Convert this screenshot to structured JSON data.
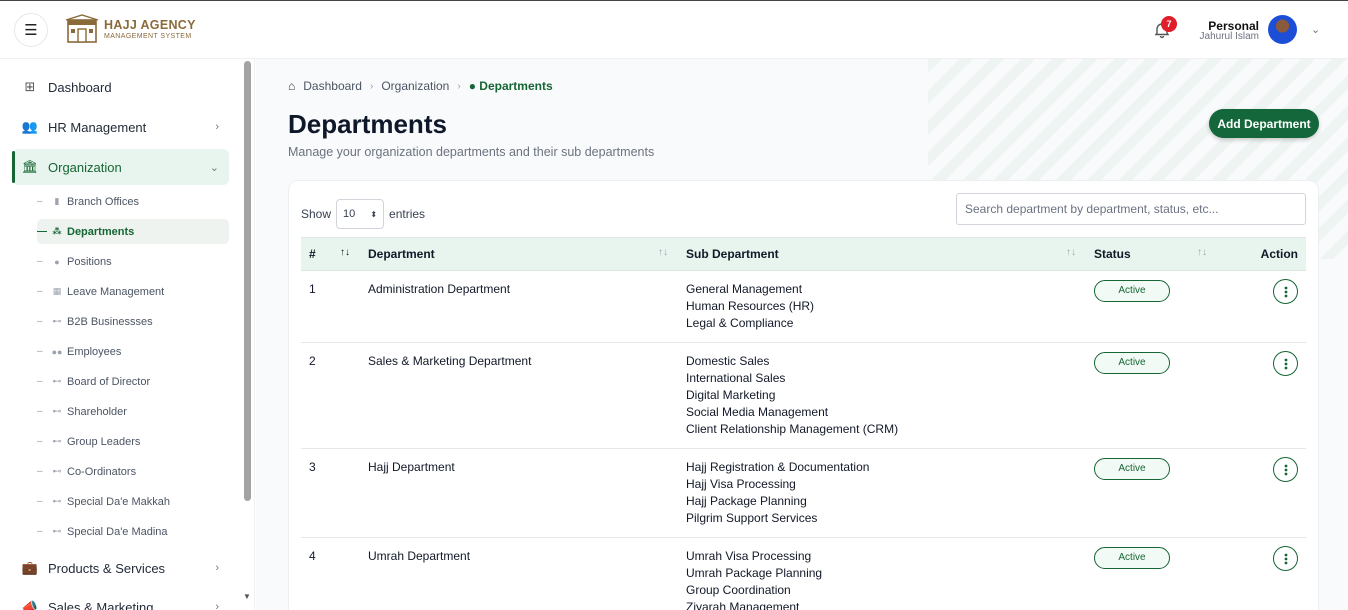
{
  "header": {
    "logo_title": "HAJJ AGENCY",
    "logo_sub": "MANAGEMENT SYSTEM",
    "notification_count": "7",
    "user_name": "Personal",
    "user_sub": "Jahurul Islam"
  },
  "sidebar": {
    "items": [
      {
        "label": "Dashboard",
        "icon": "grid-icon"
      },
      {
        "label": "HR Management",
        "icon": "users-icon"
      },
      {
        "label": "Organization",
        "icon": "bank-icon"
      },
      {
        "label": "Products & Services",
        "icon": "briefcase-icon"
      },
      {
        "label": "Sales & Marketing",
        "icon": "megaphone-icon"
      }
    ],
    "sub_items": [
      {
        "label": "Branch Offices"
      },
      {
        "label": "Departments"
      },
      {
        "label": "Positions"
      },
      {
        "label": "Leave Management"
      },
      {
        "label": "B2B Businessses"
      },
      {
        "label": "Employees"
      },
      {
        "label": "Board of Director"
      },
      {
        "label": "Shareholder"
      },
      {
        "label": "Group Leaders"
      },
      {
        "label": "Co-Ordinators"
      },
      {
        "label": "Special Da'e Makkah"
      },
      {
        "label": "Special Da'e Madina"
      }
    ]
  },
  "breadcrumb": [
    "Dashboard",
    "Organization",
    "Departments"
  ],
  "page": {
    "title": "Departments",
    "subtitle": "Manage your organization departments and their sub departments",
    "add_button": "Add Department"
  },
  "table_controls": {
    "show_label": "Show",
    "entries_value": "10",
    "entries_label": "entries",
    "search_placeholder": "Search department by department, status, etc..."
  },
  "table": {
    "columns": [
      "#",
      "Department",
      "Sub Department",
      "Status",
      "Action"
    ],
    "rows": [
      {
        "num": "1",
        "department": "Administration Department",
        "subs": [
          "General Management",
          "Human Resources (HR)",
          "Legal & Compliance"
        ],
        "status": "Active"
      },
      {
        "num": "2",
        "department": "Sales & Marketing Department",
        "subs": [
          "Domestic Sales",
          "International Sales",
          "Digital Marketing",
          "Social Media Management",
          "Client Relationship Management (CRM)"
        ],
        "status": "Active"
      },
      {
        "num": "3",
        "department": "Hajj Department",
        "subs": [
          "Hajj Registration & Documentation",
          "Hajj Visa Processing",
          "Hajj Package Planning",
          "Pilgrim Support Services"
        ],
        "status": "Active"
      },
      {
        "num": "4",
        "department": "Umrah Department",
        "subs": [
          "Umrah Visa Processing",
          "Umrah Package Planning",
          "Group Coordination",
          "Ziyarah Management"
        ],
        "status": "Active"
      }
    ]
  },
  "colors": {
    "brand": "#14673a",
    "active_bg": "#e8f5ee",
    "badge": "#e11d2a"
  }
}
